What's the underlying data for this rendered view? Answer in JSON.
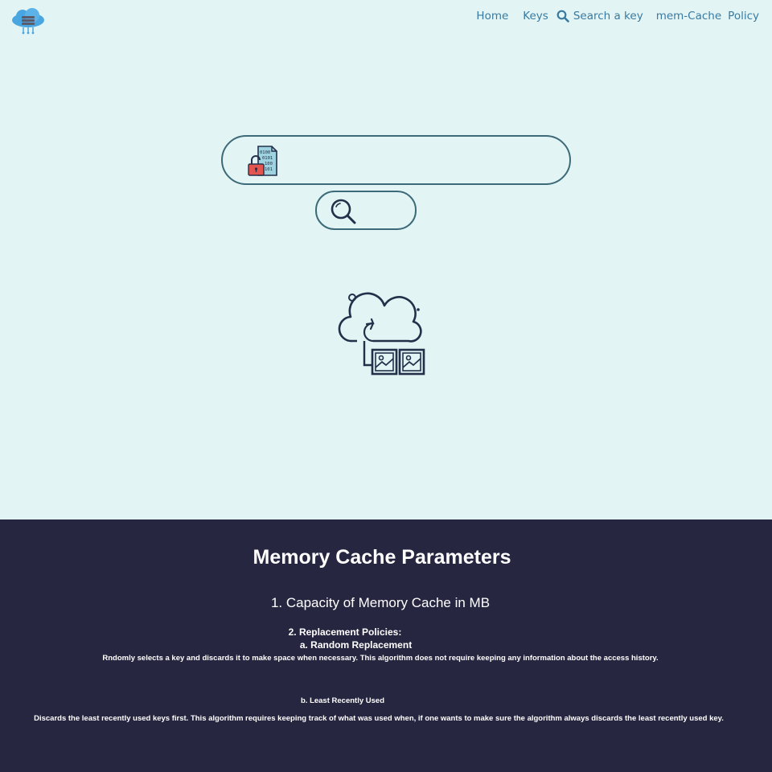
{
  "nav": {
    "home": "Home",
    "keys": "Keys",
    "search": "Search a key",
    "mem_cache": "mem-Cache",
    "policy": "Policy"
  },
  "search": {
    "key_placeholder": ""
  },
  "footer": {
    "title": "Memory Cache Parameters",
    "capacity": "1. Capacity of Memory Cache in MB",
    "policies_heading": "2. Replacement Policies:",
    "random_heading": "a. Random Replacement",
    "random_desc": "Rndomly selects a key and discards it to make space when necessary. This algorithm does not require keeping any information about the access history.",
    "lru_heading": "b. Least Recently Used",
    "lru_desc": "Discards the least recently used keys first. This algorithm requires keeping track of what was used when, if one wants to make sure the algorithm always discards the least recently used key."
  },
  "colors": {
    "page_bg": "#e2f4f4",
    "nav_link": "#3a7aa0",
    "input_border": "#3d6a78",
    "footer_bg": "#262640",
    "footer_text": "#ffffff"
  },
  "icons": {
    "logo": "cloud-server-icon",
    "nav_search": "search-icon",
    "key_field": "lock-data-file-icon",
    "search_button": "magnifier-icon",
    "illustration": "cloud-sync-images-icon"
  }
}
